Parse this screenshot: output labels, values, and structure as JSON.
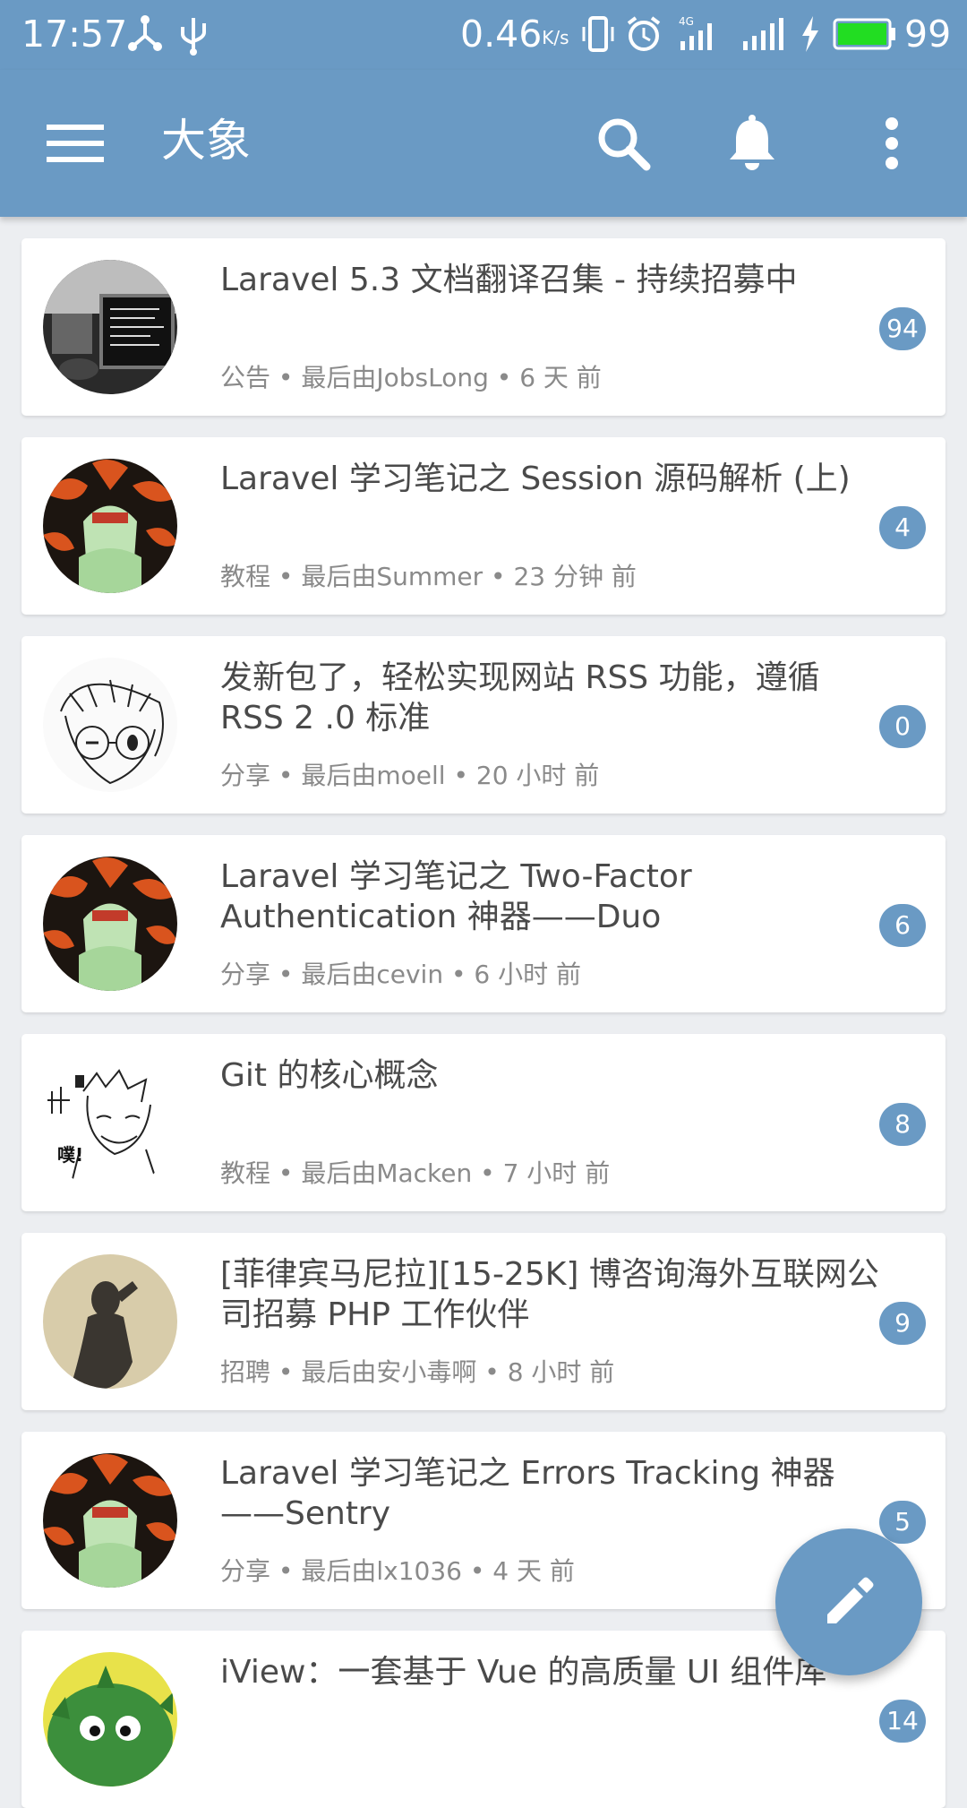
{
  "status_bar": {
    "time": "17:57",
    "speed": "0.46",
    "speed_unit": "K/s",
    "battery": "99",
    "icons": [
      "share-icon",
      "usb-icon",
      "vibrate-icon",
      "alarm-icon",
      "signal-4g-icon",
      "signal-icon",
      "charging-icon",
      "battery-icon"
    ]
  },
  "app_bar": {
    "title": "大象",
    "icons": [
      "menu-icon",
      "search-icon",
      "bell-icon",
      "more-vert-icon"
    ]
  },
  "topics": [
    {
      "title": "Laravel 5.3 文档翻译召集 - 持续招募中",
      "category": "公告",
      "last_by": "最后由JobsLong",
      "time": "6 天 前",
      "replies": "94",
      "avatar": "laptop-photo"
    },
    {
      "title": "Laravel 学习笔记之 Session 源码解析 (上)",
      "category": "教程",
      "last_by": "最后由Summer",
      "time": "23 分钟 前",
      "replies": "4",
      "avatar": "anime-fire"
    },
    {
      "title": "发新包了，轻松实现网站 RSS 功能，遵循 RSS 2 .0 标准",
      "category": "分享",
      "last_by": "最后由moell",
      "time": "20 小时 前",
      "replies": "0",
      "avatar": "anime-sketch"
    },
    {
      "title": "Laravel 学习笔记之 Two-Factor Authentication 神器——Duo",
      "category": "分享",
      "last_by": "最后由cevin",
      "time": "6 小时 前",
      "replies": "6",
      "avatar": "anime-fire"
    },
    {
      "title": "Git 的核心概念",
      "category": "教程",
      "last_by": "最后由Macken",
      "time": "7 小时 前",
      "replies": "8",
      "avatar": "manga-sketch"
    },
    {
      "title": "[菲律宾马尼拉][15-25K] 博咨询海外互联网公司招募 PHP 工作伙伴",
      "category": "招聘",
      "last_by": "最后由安小毒啊",
      "time": "8 小时 前",
      "replies": "9",
      "avatar": "shadow-photo"
    },
    {
      "title": "Laravel 学习笔记之 Errors Tracking 神器——Sentry",
      "category": "分享",
      "last_by": "最后由lx1036",
      "time": "4 天 前",
      "replies": "5",
      "avatar": "anime-fire"
    },
    {
      "title": "iView：一套基于 Vue 的高质量 UI 组件库",
      "category": "",
      "last_by": "",
      "time": "",
      "replies": "14",
      "avatar": "green-monster"
    }
  ],
  "colors": {
    "primary": "#6a9ac4",
    "background": "#eceef1",
    "card": "#ffffff",
    "title_text": "#4a4a4a",
    "meta_text": "#8a8a8a"
  },
  "fab": {
    "icon": "pencil-icon"
  }
}
